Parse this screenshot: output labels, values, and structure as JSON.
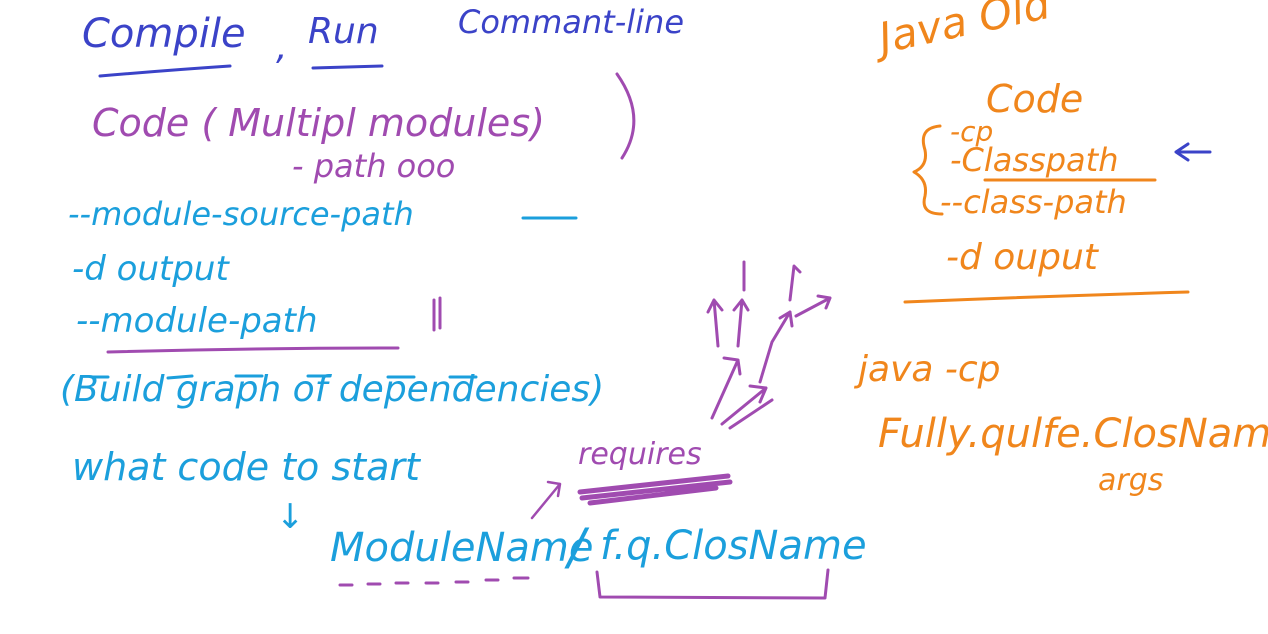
{
  "title": {
    "compile": "Compile",
    "comma": ",",
    "run": "Run",
    "commandline": "Commant-line"
  },
  "left": {
    "code_line": "Code  ( Multipl modules)",
    "path_line": "- path ooo",
    "module_source_path": "--module-source-path",
    "d_output": "-d      output",
    "module_path": "--module-path",
    "build_graph": "(Build  graph  of  dependencies)",
    "what_code": "what code to start",
    "arrow_down": "↓",
    "module_name": "ModuleName",
    "slash": "/",
    "fq_class": "f.q.ClosName",
    "requires": "requires"
  },
  "right": {
    "java_old": "Java  Old",
    "code": "Code",
    "cp": "-cp",
    "classpath": "-Classpath",
    "class_path": "--class-path",
    "d_output": "-d  ouput",
    "java_cp": "java  -cp",
    "fully_qualified": "Fully.qulfe.ClosName",
    "args": "args"
  },
  "colors": {
    "title": "#3b43c8",
    "module_section": "#a04bb0",
    "options": "#1b9fdc",
    "java_old": "#f0861c"
  }
}
